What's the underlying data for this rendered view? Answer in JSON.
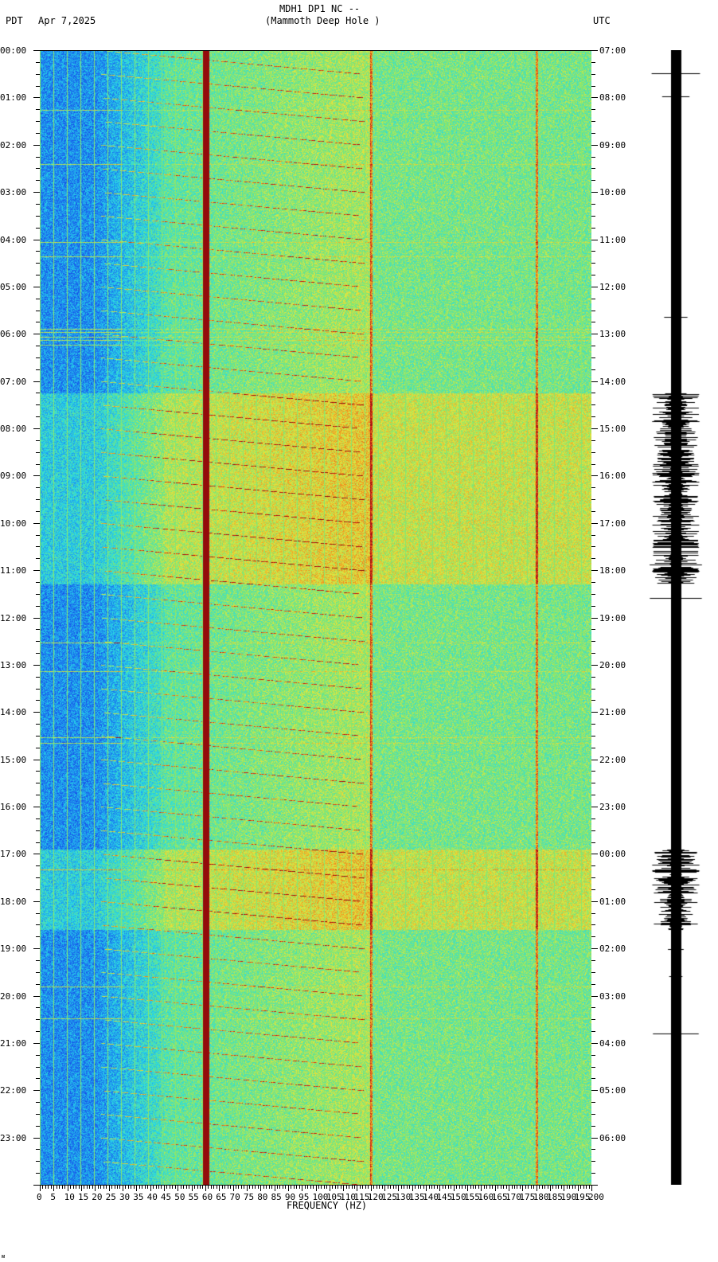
{
  "header": {
    "station": "MDH1 DP1 NC --",
    "site": "(Mammoth Deep Hole )",
    "left_tz": "PDT",
    "date": "Apr 7,2025",
    "right_tz": "UTC"
  },
  "chart_data": {
    "type": "heatmap",
    "title": "MDH1 DP1 NC -- (Mammoth Deep Hole )",
    "xlabel": "FREQUENCY (HZ)",
    "xlim": [
      0,
      200
    ],
    "x_ticks": [
      0,
      5,
      10,
      15,
      20,
      25,
      30,
      35,
      40,
      45,
      50,
      55,
      60,
      65,
      70,
      75,
      80,
      85,
      90,
      95,
      100,
      105,
      110,
      115,
      120,
      125,
      130,
      135,
      140,
      145,
      150,
      155,
      160,
      165,
      170,
      175,
      180,
      185,
      190,
      195,
      200
    ],
    "ylim_hours": [
      0,
      24
    ],
    "left_y_ticks": [
      "00:00",
      "01:00",
      "02:00",
      "03:00",
      "04:00",
      "05:00",
      "06:00",
      "07:00",
      "08:00",
      "09:00",
      "10:00",
      "11:00",
      "12:00",
      "13:00",
      "14:00",
      "15:00",
      "16:00",
      "17:00",
      "18:00",
      "19:00",
      "20:00",
      "21:00",
      "22:00",
      "23:00"
    ],
    "right_y_ticks": [
      "07:00",
      "08:00",
      "09:00",
      "10:00",
      "11:00",
      "12:00",
      "13:00",
      "14:00",
      "15:00",
      "16:00",
      "17:00",
      "18:00",
      "19:00",
      "20:00",
      "21:00",
      "22:00",
      "23:00",
      "00:00",
      "01:00",
      "02:00",
      "03:00",
      "04:00",
      "05:00",
      "06:00"
    ],
    "persistent_lines_hz": [
      60,
      120,
      180
    ],
    "high_energy_periods_pdt_hours": [
      [
        7.25,
        11.3
      ],
      [
        16.9,
        18.6
      ]
    ]
  },
  "footer": {
    "mark": "ᴍ"
  }
}
